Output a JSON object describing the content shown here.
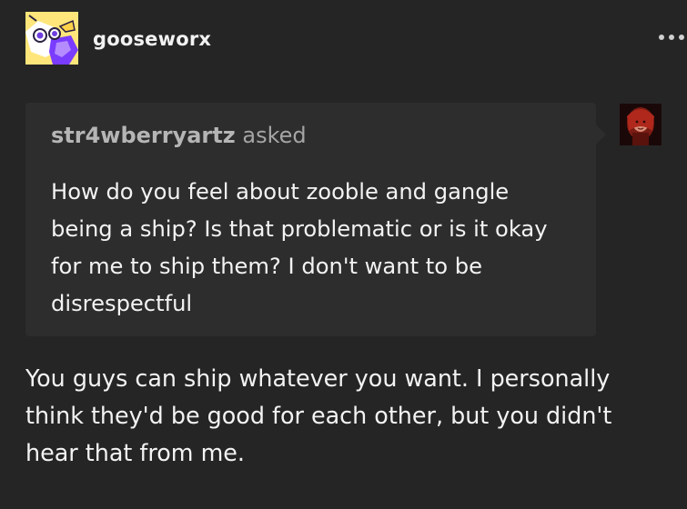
{
  "post": {
    "blog_name": "gooseworx",
    "avatar_icon": "goose-cartoon-avatar",
    "more_icon": "ellipsis-icon"
  },
  "ask": {
    "asker_name": "str4wberryartz",
    "asked_label": "asked",
    "asker_avatar_icon": "asker-portrait-avatar",
    "question": "How do you feel about zooble and gangle being a ship? Is that problematic or is it okay for me to ship them? I don't want to be disrespectful"
  },
  "answer": {
    "text": "You guys can ship whatever you want. I personally think they'd be good for each other, but you didn't hear that from me."
  },
  "colors": {
    "background": "#252525",
    "ask_box": "#2d2d2d",
    "text": "#f3f3f3",
    "muted": "#a9a9a9",
    "avatar_yellow": "#ffe67a",
    "avatar_purple": "#7a3cff"
  }
}
